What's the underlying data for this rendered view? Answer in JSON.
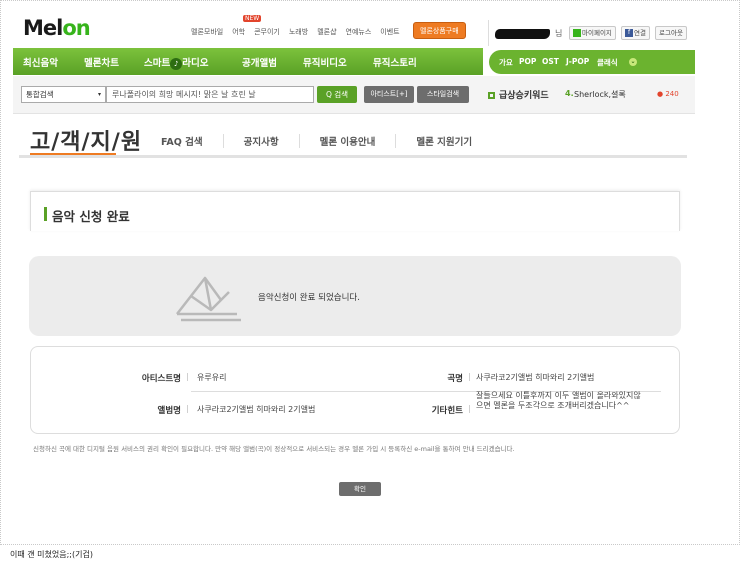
{
  "logo": {
    "text_a": "Mel",
    "text_b": "on"
  },
  "top_links": [
    "멜론모바일",
    "어학",
    "콘무이기",
    "노래방",
    "멜론샵",
    "연예뉴스",
    "이벤트"
  ],
  "top_links_badge": "NEW",
  "buy_button": "멜론상품구매",
  "user": {
    "suffix": "님",
    "my_page": "마이페이지",
    "facebook": "연결",
    "facebook_icon": "f",
    "logout": "로그아웃"
  },
  "menu": {
    "items": [
      "최신음악",
      "멜론차트",
      "스마트",
      "라디오",
      "공개앨범",
      "뮤직비디오",
      "뮤직스토리"
    ],
    "radio_icon": "♪"
  },
  "genres": {
    "items": [
      "가요",
      "POP",
      "OST",
      "J-POP",
      "클래식"
    ],
    "more_icon": "⌄"
  },
  "search": {
    "select_value": "통합검색",
    "select_chevron": "▾",
    "input_value": "루나폴라이의 희망 메시지! 맑은 날 흐린 날",
    "search_button": "Q 검색",
    "artist_button": "아티스트[+]",
    "style_button": "스타일검색"
  },
  "rising": {
    "title": "급상승키워드",
    "rank": "4.",
    "keyword": "Sherlock,셜록",
    "count": "● 240"
  },
  "support": {
    "title": "고/객/지/원",
    "tabs": [
      "FAQ 검색",
      "공지사항",
      "멜론 이용안내",
      "멜론 지원기기"
    ]
  },
  "section": {
    "heading": "음악 신청 완료"
  },
  "done": {
    "message": "음악신청이 완료 되었습니다."
  },
  "info": {
    "artist_label": "아티스트명",
    "artist_value": "유루유리",
    "song_label": "곡명",
    "song_value": "사쿠라코2기앨범 히마와리 2기앨범",
    "album_label": "앨범명",
    "album_value": "사쿠라코2기앨범 히마와리 2기앨범",
    "etc_label": "기타힌트",
    "etc_value": "잘들으세요 이틀후까지 이두 앨범이 올라와있지않으면 멜론을 두조각으로 조개버리겠습니다^^",
    "separator": "|"
  },
  "notice": "신청하신 곡에 대한 디지털 음원 서비스의 권리 확인이 필요합니다. 만약 해당 앨범(곡)이 정상적으로 서비스되는 경우 멜론 가입 시 등록하신 e-mail을 통하여 안내 드리겠습니다.",
  "confirm_button": "확인",
  "caption": "이때 걘 미쳤었음;;(기겁)"
}
